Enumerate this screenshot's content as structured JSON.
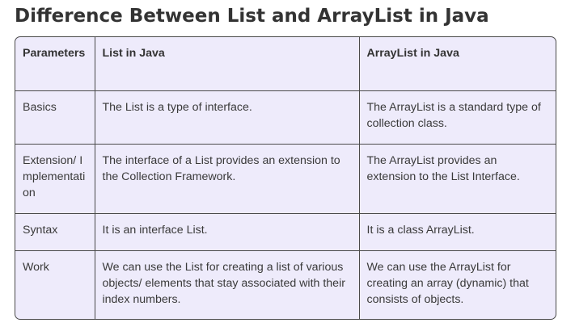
{
  "title": "Difference Between List and ArrayList in Java",
  "table": {
    "headers": [
      "Parameters",
      "List in Java",
      "ArrayList in Java"
    ],
    "rows": [
      {
        "parameter": "Basics",
        "list": "The List is a type of interface.",
        "arraylist": "The ArrayList is a standard type of collection class."
      },
      {
        "parameter": "Extension/ Implementation",
        "list": "The interface of a List provides an extension to the Collection Framework.",
        "arraylist": "The ArrayList provides an extension to the List Interface."
      },
      {
        "parameter": "Syntax",
        "list": "It is an interface List.",
        "arraylist": "It is a class ArrayList."
      },
      {
        "parameter": "Work",
        "list": "We can use the List for creating a list of various objects/ elements that stay associated with their index numbers.",
        "arraylist": "We can use the ArrayList for creating an array (dynamic) that consists of objects."
      }
    ]
  },
  "colors": {
    "cell_background": "#eeebfb",
    "border": "#4a4a4a",
    "title_text": "#333333"
  }
}
